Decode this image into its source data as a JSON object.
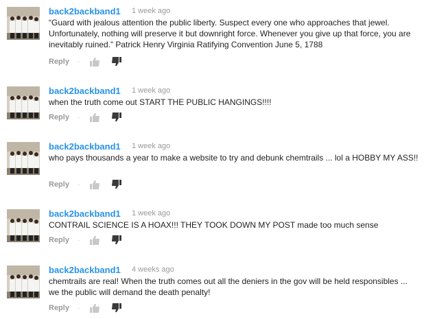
{
  "comments": [
    {
      "author": "back2backband1",
      "time": "1 week ago",
      "text": "“Guard with jealous attention the public liberty. Suspect every one who approaches that jewel. Unfortunately, nothing will preserve it but downright force. Whenever you give up that force, you are inevitably ruined.” Patrick Henry Virginia Ratifying Convention June 5, 1788",
      "reply_label": "Reply",
      "separator": "·"
    },
    {
      "author": "back2backband1",
      "time": "1 week ago",
      "text": "when the truth come out START THE PUBLIC HANGINGS!!!!",
      "reply_label": "Reply",
      "separator": "·"
    },
    {
      "author": "back2backband1",
      "time": "1 week ago",
      "text": "who pays thousands a year to make a website to try and debunk chemtrails ... lol a HOBBY MY ASS!!",
      "reply_label": "Reply",
      "separator": "·"
    },
    {
      "author": "back2backband1",
      "time": "1 week ago",
      "text": "CONTRAIL SCIENCE IS A HOAX!!! THEY TOOK DOWN MY POST made too much sense",
      "reply_label": "Reply",
      "separator": "·"
    },
    {
      "author": "back2backband1",
      "time": "4 weeks ago",
      "text": "chemtrails are real! When the truth comes out all the deniers in the gov will be held responsibles ... we the public will demand the death penalty!",
      "reply_label": "Reply",
      "separator": "·"
    }
  ],
  "icons": {
    "like": "thumbs-up-icon",
    "dislike": "thumbs-down-icon"
  },
  "colors": {
    "author": "#2793e6",
    "meta": "#999999",
    "text": "#222222"
  }
}
